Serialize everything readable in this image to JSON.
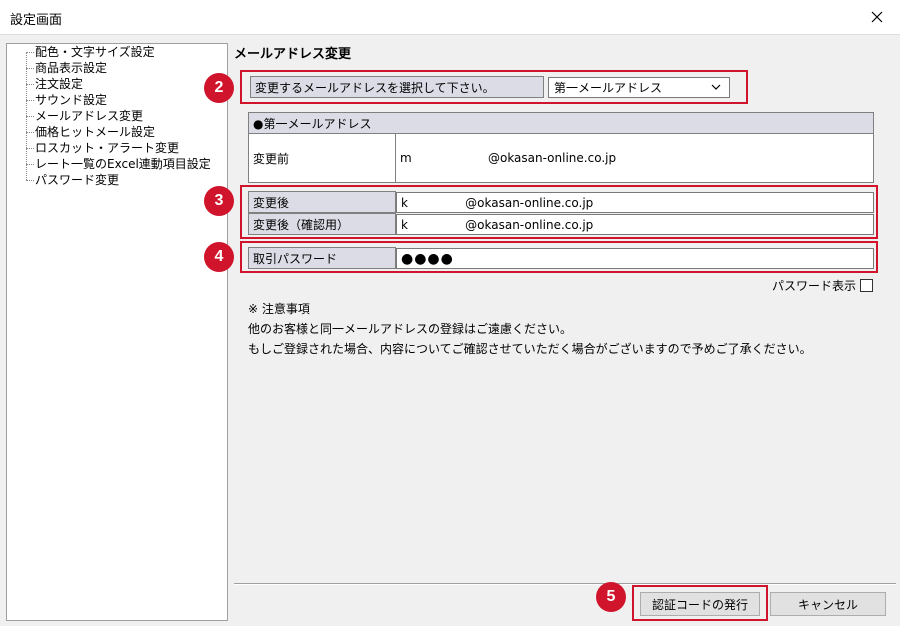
{
  "window": {
    "title": "設定画面"
  },
  "tree": {
    "items": [
      "配色・文字サイズ設定",
      "商品表示設定",
      "注文設定",
      "サウンド設定",
      "メールアドレス変更",
      "価格ヒットメール設定",
      "ロスカット・アラート変更",
      "レート一覧のExcel連動項目設定",
      "パスワード変更"
    ]
  },
  "section": {
    "title": "メールアドレス変更"
  },
  "select_row": {
    "label": "変更するメールアドレスを選択して下さい。",
    "selected": "第一メールアドレス"
  },
  "email_table": {
    "header": "●第一メールアドレス",
    "before_label": "変更前",
    "before_value": "m                    @okasan-online.co.jp",
    "after_label": "変更後",
    "after_value": "k               @okasan-online.co.jp",
    "confirm_label": "変更後（確認用）",
    "confirm_value": "k               @okasan-online.co.jp"
  },
  "password_row": {
    "label": "取引パスワード",
    "value": "●●●●"
  },
  "password_show": {
    "label": "パスワード表示"
  },
  "notes": {
    "heading": "※ 注意事項",
    "line1": "他のお客様と同一メールアドレスの登録はご遠慮ください。",
    "line2": "もしご登録された場合、内容についてご確認させていただく場合がございますので予めご了承ください。"
  },
  "buttons": {
    "issue_code": "認証コードの発行",
    "cancel": "キャンセル"
  },
  "badges": [
    "2",
    "3",
    "4",
    "5"
  ],
  "colors": {
    "highlight": "#d0142c",
    "label_bg": "#dcdce6"
  }
}
